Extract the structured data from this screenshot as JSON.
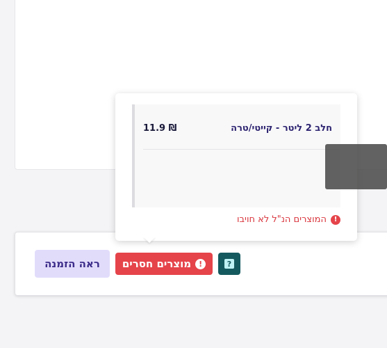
{
  "order_card": {
    "view_order_label": "ראה הזמנה",
    "missing_products_label": "מוצרים חסרים",
    "missing_icon": "exclamation-circle-icon",
    "help_icon": "question-square-icon"
  },
  "popover": {
    "items": [
      {
        "name": "חלב 2 ליטר - קייטי/טרה",
        "price": "11.9 ₪"
      }
    ],
    "note": "המוצרים הנ\"ל לא חויבו",
    "note_icon": "exclamation-circle-icon"
  },
  "colors": {
    "primary_purple": "#3c2c8a",
    "view_order_bg": "#e2dcfb",
    "danger_red": "#e5444a",
    "help_teal": "#14595e"
  }
}
